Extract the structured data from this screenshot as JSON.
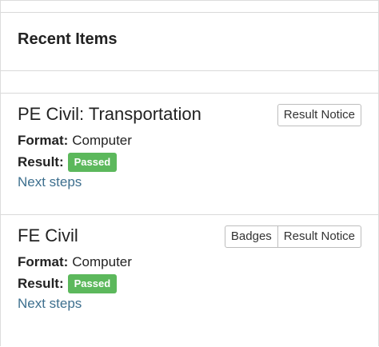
{
  "panel": {
    "title": "Recent Items"
  },
  "items": [
    {
      "title": "PE Civil: Transportation",
      "buttons": [
        "Result Notice"
      ],
      "format_label": "Format:",
      "format_value": "Computer",
      "result_label": "Result:",
      "result_value": "Passed",
      "link_label": "Next steps"
    },
    {
      "title": "FE Civil",
      "buttons": [
        "Badges",
        "Result Notice"
      ],
      "format_label": "Format:",
      "format_value": "Computer",
      "result_label": "Result:",
      "result_value": "Passed",
      "link_label": "Next steps"
    }
  ],
  "colors": {
    "passed_badge": "#5cb85c",
    "link": "#3d6f8e",
    "border": "#d9d9d9"
  }
}
